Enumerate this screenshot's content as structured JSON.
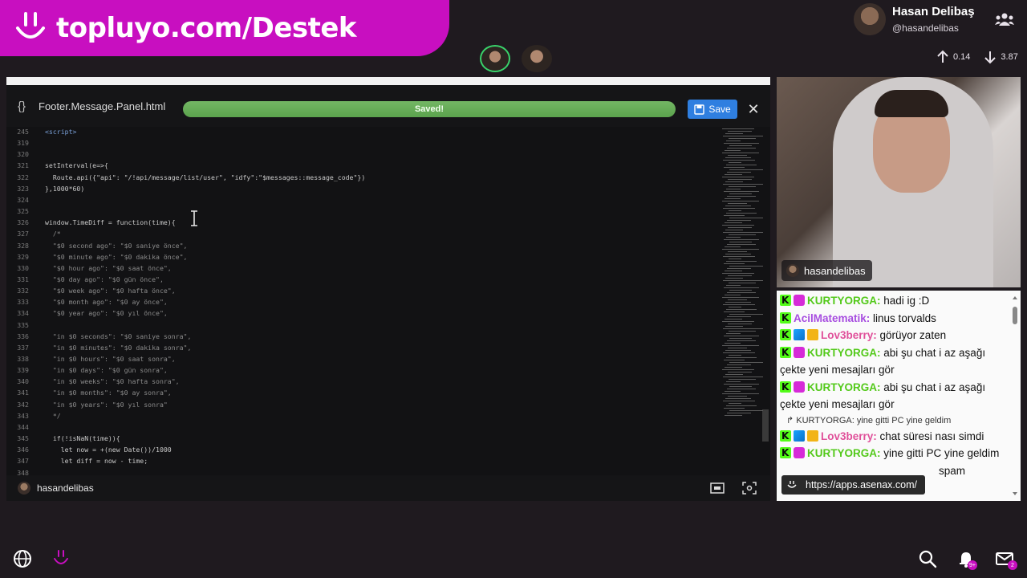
{
  "banner": {
    "text": "topluyo.com/Destek"
  },
  "profile": {
    "name": "Hasan Delibaş",
    "handle": "@hasandelibas"
  },
  "stats": {
    "upload": "0.14",
    "download": "3.87"
  },
  "editor": {
    "file_name": "Footer.Message.Panel.html",
    "status_text": "Saved!",
    "save_label": "Save",
    "lines": [
      {
        "n": "245",
        "text": "<script>"
      },
      {
        "n": "319",
        "text": ""
      },
      {
        "n": "320",
        "text": ""
      },
      {
        "n": "321",
        "text": "setInterval(e=>{"
      },
      {
        "n": "322",
        "text": "  Route.api({\"api\": \"/!api/message/list/user\", \"idfy\":\"$messages::message_code\"})"
      },
      {
        "n": "323",
        "text": "},1000*60)"
      },
      {
        "n": "324",
        "text": ""
      },
      {
        "n": "325",
        "text": ""
      },
      {
        "n": "326",
        "text": "window.TimeDiff = function(time){"
      },
      {
        "n": "327",
        "text": "  /*"
      },
      {
        "n": "328",
        "text": "  \"$0 second ago\": \"$0 saniye önce\","
      },
      {
        "n": "329",
        "text": "  \"$0 minute ago\": \"$0 dakika önce\","
      },
      {
        "n": "330",
        "text": "  \"$0 hour ago\": \"$0 saat önce\","
      },
      {
        "n": "331",
        "text": "  \"$0 day ago\": \"$0 gün önce\","
      },
      {
        "n": "332",
        "text": "  \"$0 week ago\": \"$0 hafta önce\","
      },
      {
        "n": "333",
        "text": "  \"$0 month ago\": \"$0 ay önce\","
      },
      {
        "n": "334",
        "text": "  \"$0 year ago\": \"$0 yıl önce\","
      },
      {
        "n": "335",
        "text": ""
      },
      {
        "n": "336",
        "text": "  \"in $0 seconds\": \"$0 saniye sonra\","
      },
      {
        "n": "337",
        "text": "  \"in $0 minutes\": \"$0 dakika sonra\","
      },
      {
        "n": "338",
        "text": "  \"in $0 hours\": \"$0 saat sonra\","
      },
      {
        "n": "339",
        "text": "  \"in $0 days\": \"$0 gün sonra\","
      },
      {
        "n": "340",
        "text": "  \"in $0 weeks\": \"$0 hafta sonra\","
      },
      {
        "n": "341",
        "text": "  \"in $0 months\": \"$0 ay sonra\","
      },
      {
        "n": "342",
        "text": "  \"in $0 years\": \"$0 yıl sonra\""
      },
      {
        "n": "343",
        "text": "  */"
      },
      {
        "n": "344",
        "text": ""
      },
      {
        "n": "345",
        "text": "  if(!isNaN(time)){"
      },
      {
        "n": "346",
        "text": "    let now = +(new Date())/1000"
      },
      {
        "n": "347",
        "text": "    let diff = now - time;"
      },
      {
        "n": "348",
        "text": ""
      }
    ],
    "footer_user": "hasandelibas"
  },
  "webcam": {
    "label": "hasandelibas"
  },
  "chat": {
    "messages": [
      {
        "badges": [
          "kick",
          "sub"
        ],
        "user": "KURTYORGA",
        "color": "#53c91a",
        "text": "hadi ig :D"
      },
      {
        "badges": [
          "kick"
        ],
        "user": "AcilMatematik",
        "color": "#a74de0",
        "text": "linus torvalds"
      },
      {
        "badges": [
          "kick",
          "sword",
          "crown"
        ],
        "user": "Lov3berry",
        "color": "#e0509a",
        "text": "görüyor zaten"
      },
      {
        "badges": [
          "kick",
          "sub"
        ],
        "user": "KURTYORGA",
        "color": "#53c91a",
        "text": "abi şu chat i az aşağı çekte yeni mesajları gör"
      },
      {
        "badges": [
          "kick",
          "sub"
        ],
        "user": "KURTYORGA",
        "color": "#53c91a",
        "text": "abi şu chat i az aşağı çekte yeni mesajları gör"
      },
      {
        "reply": "↱ KURTYORGA: yine gitti PC yine geldim"
      },
      {
        "badges": [
          "kick",
          "sword",
          "crown"
        ],
        "user": "Lov3berry",
        "color": "#e0509a",
        "text": "chat süresi nası simdi"
      },
      {
        "badges": [
          "kick",
          "sub"
        ],
        "user": "KURTYORGA",
        "color": "#53c91a",
        "text": "yine gitti PC yine geldim"
      },
      {
        "badges": [],
        "user": "",
        "color": "#111111",
        "text": "spam"
      }
    ],
    "link": "https://apps.asenax.com/"
  },
  "colors": {
    "brand": "#c80fc0",
    "saved_green": "#5ba34d",
    "save_blue": "#2f7fe0",
    "kick_green": "#53fc18"
  }
}
